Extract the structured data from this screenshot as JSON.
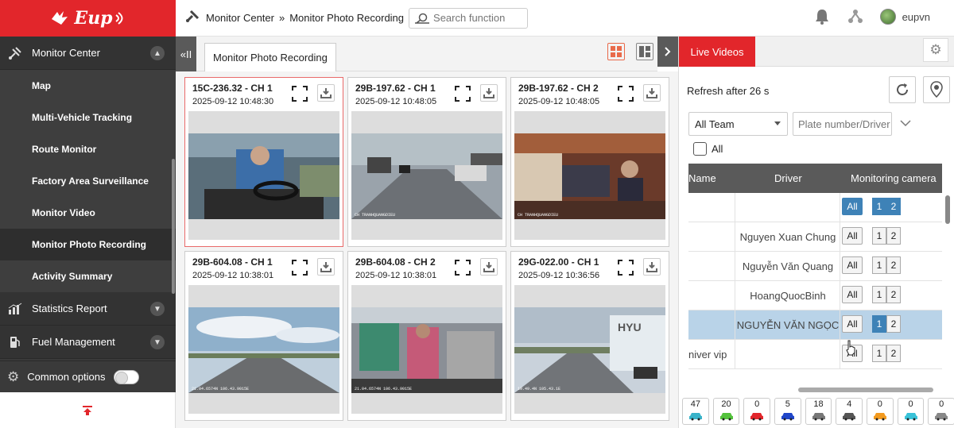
{
  "app": {
    "logo_text": "Eup",
    "user_name": "eupvn"
  },
  "breadcrumb": {
    "section": "Monitor Center",
    "separator": "»",
    "page": "Monitor Photo Recording"
  },
  "search": {
    "placeholder": "Search function"
  },
  "sidebar": {
    "group_monitor": "Monitor Center",
    "items": [
      {
        "label": "Map"
      },
      {
        "label": "Multi-Vehicle Tracking"
      },
      {
        "label": "Route Monitor"
      },
      {
        "label": "Factory Area Surveillance"
      },
      {
        "label": "Monitor Video"
      },
      {
        "label": "Monitor Photo Recording"
      },
      {
        "label": "Activity Summary"
      }
    ],
    "group_statistics": "Statistics Report",
    "group_fuel": "Fuel Management",
    "common_options": "Common options"
  },
  "tabs": {
    "active": "Monitor Photo Recording",
    "collapse_label": "«II"
  },
  "cards": [
    {
      "title": "15C-236.32 - CH 1",
      "time": "2025-09-12 10:48:30",
      "scene": "cabin",
      "overlay": ""
    },
    {
      "title": "29B-197.62 - CH 1",
      "time": "2025-09-12 10:48:05",
      "scene": "street",
      "overlay": "CH  TRANHQUANGDIEU"
    },
    {
      "title": "29B-197.62 - CH 2",
      "time": "2025-09-12 10:48:05",
      "scene": "bus",
      "overlay": "CH  TRANHQUANGDIEU"
    },
    {
      "title": "29B-604.08 - CH 1",
      "time": "2025-09-12 10:38:01",
      "scene": "highway",
      "overlay": "21.04.6574N 106.43.9015E"
    },
    {
      "title": "29B-604.08 - CH 2",
      "time": "2025-09-12 10:38:01",
      "scene": "bus2",
      "overlay": "21.04.6574N 106.43.9015E"
    },
    {
      "title": "29G-022.00 - CH 1",
      "time": "2025-09-12 10:36:56",
      "scene": "truck",
      "overlay": "19.49.4N 105.43.1E"
    }
  ],
  "right_panel": {
    "live_tab": "Live Videos",
    "refresh_text": "Refresh after 26 s",
    "team_select": "All Team",
    "plate_placeholder": "Plate number/Driver",
    "all_label": "All",
    "columns": {
      "name": "Name",
      "driver": "Driver",
      "camera": "Monitoring camera"
    },
    "rows": [
      {
        "name": "",
        "driver": "",
        "all_on": true,
        "ch1_on": true,
        "ch2_on": true,
        "highlight": false
      },
      {
        "name": "",
        "driver": "Nguyen Xuan Chung",
        "all_on": false,
        "ch1_on": false,
        "ch2_on": false,
        "highlight": false
      },
      {
        "name": "",
        "driver": "Nguyễn Văn Quang",
        "all_on": false,
        "ch1_on": false,
        "ch2_on": false,
        "highlight": false
      },
      {
        "name": "",
        "driver": "HoangQuocBinh",
        "all_on": false,
        "ch1_on": false,
        "ch2_on": false,
        "highlight": false
      },
      {
        "name": "",
        "driver": "NGUYỄN VĂN NGỌC",
        "all_on": false,
        "ch1_on": true,
        "ch2_on": false,
        "highlight": true
      },
      {
        "name": "niver vip",
        "driver": "",
        "all_on": false,
        "ch1_on": false,
        "ch2_on": false,
        "highlight": false
      }
    ],
    "btn_all": "All",
    "btn_ch1": "1",
    "btn_ch2": "2",
    "status_counts": [
      {
        "count": "47",
        "color": "#39b3c9"
      },
      {
        "count": "20",
        "color": "#53c23b"
      },
      {
        "count": "0",
        "color": "#e2262b"
      },
      {
        "count": "5",
        "color": "#2046c9"
      },
      {
        "count": "18",
        "color": "#777777"
      },
      {
        "count": "4",
        "color": "#555555"
      },
      {
        "count": "0",
        "color": "#f29a1f"
      },
      {
        "count": "0",
        "color": "#39c2d8"
      },
      {
        "count": "0",
        "color": "#888888"
      }
    ]
  },
  "colors": {
    "brand": "#e2262b",
    "selected_blue": "#3e82b7",
    "highlight_row": "#b9d3e8"
  }
}
